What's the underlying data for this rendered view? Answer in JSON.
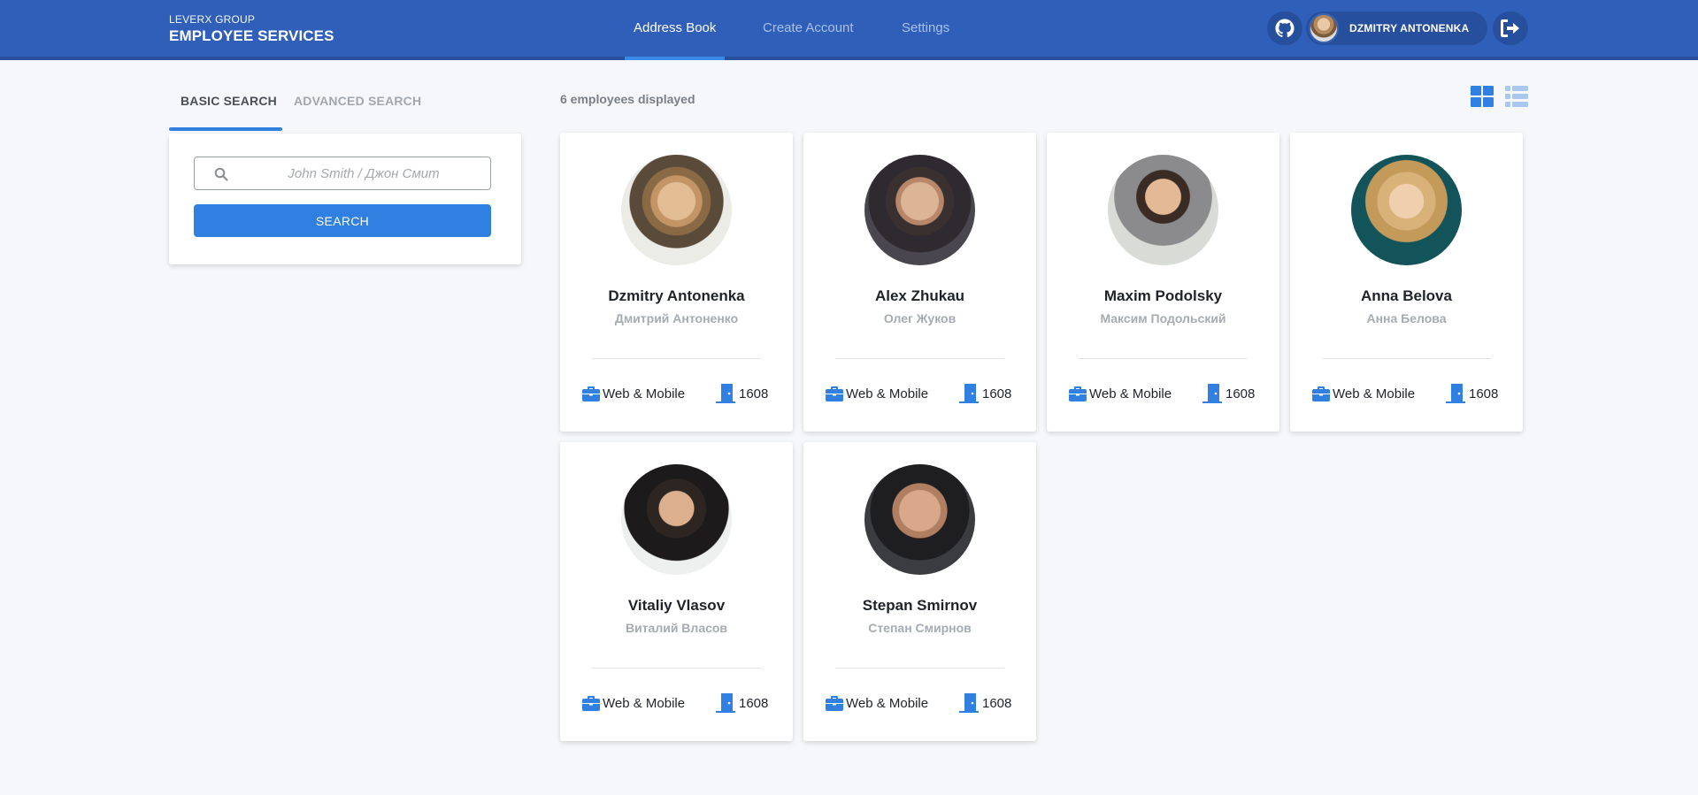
{
  "header": {
    "brand_top": "LEVERX GROUP",
    "brand_main": "EMPLOYEE SERVICES",
    "nav": [
      {
        "label": "Address Book",
        "active": true
      },
      {
        "label": "Create Account",
        "active": false
      },
      {
        "label": "Settings",
        "active": false
      }
    ],
    "github_icon": "github-icon",
    "user_name": "DZMITRY ANTONENKA",
    "logout_icon": "logout-icon",
    "colors": {
      "bar": "#2f5fb9",
      "accent": "#3a8be6"
    }
  },
  "search": {
    "tabs": [
      {
        "label": "BASIC SEARCH",
        "active": true
      },
      {
        "label": "ADVANCED SEARCH",
        "active": false
      }
    ],
    "placeholder": "John Smith / Джон Смит",
    "value": "",
    "button_label": "SEARCH"
  },
  "results": {
    "count_text": "6 employees displayed",
    "view_modes": [
      {
        "name": "grid-view-icon",
        "active": true
      },
      {
        "name": "list-view-icon",
        "active": false
      }
    ]
  },
  "employees": [
    {
      "name": "Dzmitry Antonenka",
      "name_ru": "Дмитрий Антоненко",
      "department": "Web & Mobile",
      "room": "1608"
    },
    {
      "name": "Alex Zhukau",
      "name_ru": "Олег Жуков",
      "department": "Web & Mobile",
      "room": "1608"
    },
    {
      "name": "Maxim Podolsky",
      "name_ru": "Максим Подольский",
      "department": "Web & Mobile",
      "room": "1608"
    },
    {
      "name": "Anna Belova",
      "name_ru": "Анна Белова",
      "department": "Web & Mobile",
      "room": "1608"
    },
    {
      "name": "Vitaliy Vlasov",
      "name_ru": "Виталий Власов",
      "department": "Web & Mobile",
      "room": "1608"
    },
    {
      "name": "Stepan Smirnov",
      "name_ru": "Степан Смирнов",
      "department": "Web & Mobile",
      "room": "1608"
    }
  ]
}
